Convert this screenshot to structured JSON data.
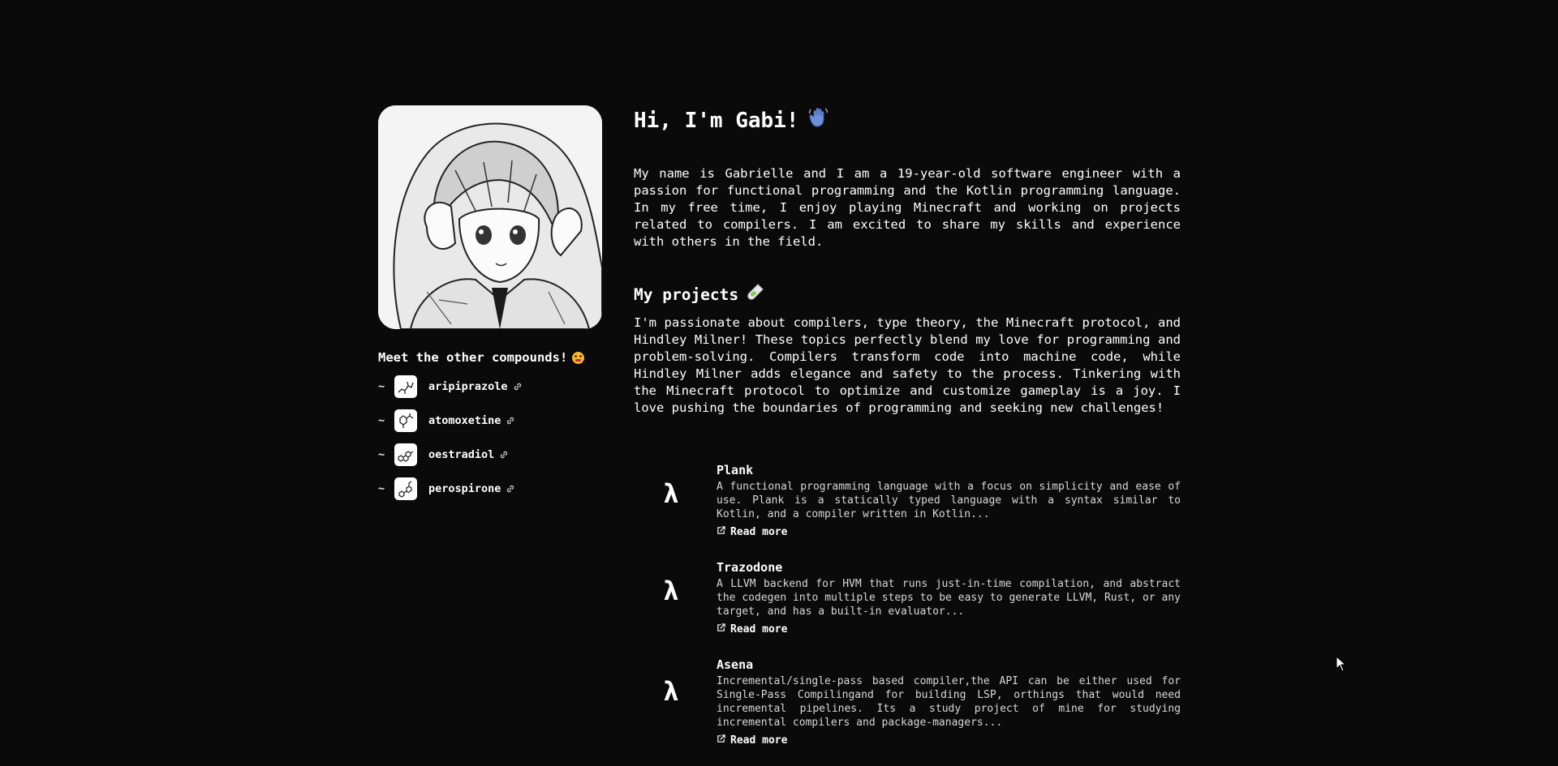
{
  "profile": {
    "greeting": "Hi, I'm Gabi!",
    "intro": "My name is Gabrielle and I am a 19-year-old software engineer with a passion for functional programming and the Kotlin programming language. In my free time, I enjoy playing Minecraft and working on projects related to compilers. I am excited to share my skills and experience with others in the field.",
    "greeting_icon": "waving-hand-emoji",
    "avatar_icon": "anime-girl-avatar"
  },
  "friends": {
    "title": "Meet the other compounds!",
    "title_icon": "grimacing-face-emoji",
    "items": [
      {
        "name": "aripiprazole",
        "icon": "molecule-icon"
      },
      {
        "name": "atomoxetine",
        "icon": "molecule-icon"
      },
      {
        "name": "oestradiol",
        "icon": "molecule-icon"
      },
      {
        "name": "perospirone",
        "icon": "molecule-icon"
      }
    ]
  },
  "projects": {
    "title": "My projects",
    "title_icon": "test-tube-emoji",
    "intro": "I'm passionate about compilers, type theory, the Minecraft protocol, and Hindley Milner! These topics perfectly blend my love for programming and problem-solving. Compilers transform code into machine code, while Hindley Milner adds elegance and safety to the process. Tinkering with the Minecraft protocol to optimize and customize gameplay is a joy. I love pushing the boundaries of programming and seeking new challenges!",
    "read_more_label": "Read more",
    "items": [
      {
        "symbol": "λ",
        "name": "Plank",
        "description": "A functional programming language with a focus on simplicity and ease of use. Plank is a statically typed language with a syntax similar to Kotlin, and a compiler written in Kotlin..."
      },
      {
        "symbol": "λ",
        "name": "Trazodone",
        "description": "A LLVM backend for HVM that runs just-in-time compilation, and abstract the codegen into multiple steps to be easy to generate LLVM, Rust, or any target, and has a built-in evaluator..."
      },
      {
        "symbol": "λ",
        "name": "Asena",
        "description": "Incremental/single-pass based compiler,the API can be either used for Single-Pass Compilingand for building LSP, orthings that would need incremental pipelines. Its a study project of mine for studying incremental compilers and package-managers..."
      }
    ]
  },
  "colors": {
    "background": "#0a0a0a",
    "text": "#ffffff",
    "muted_text": "#d8d8d8"
  }
}
